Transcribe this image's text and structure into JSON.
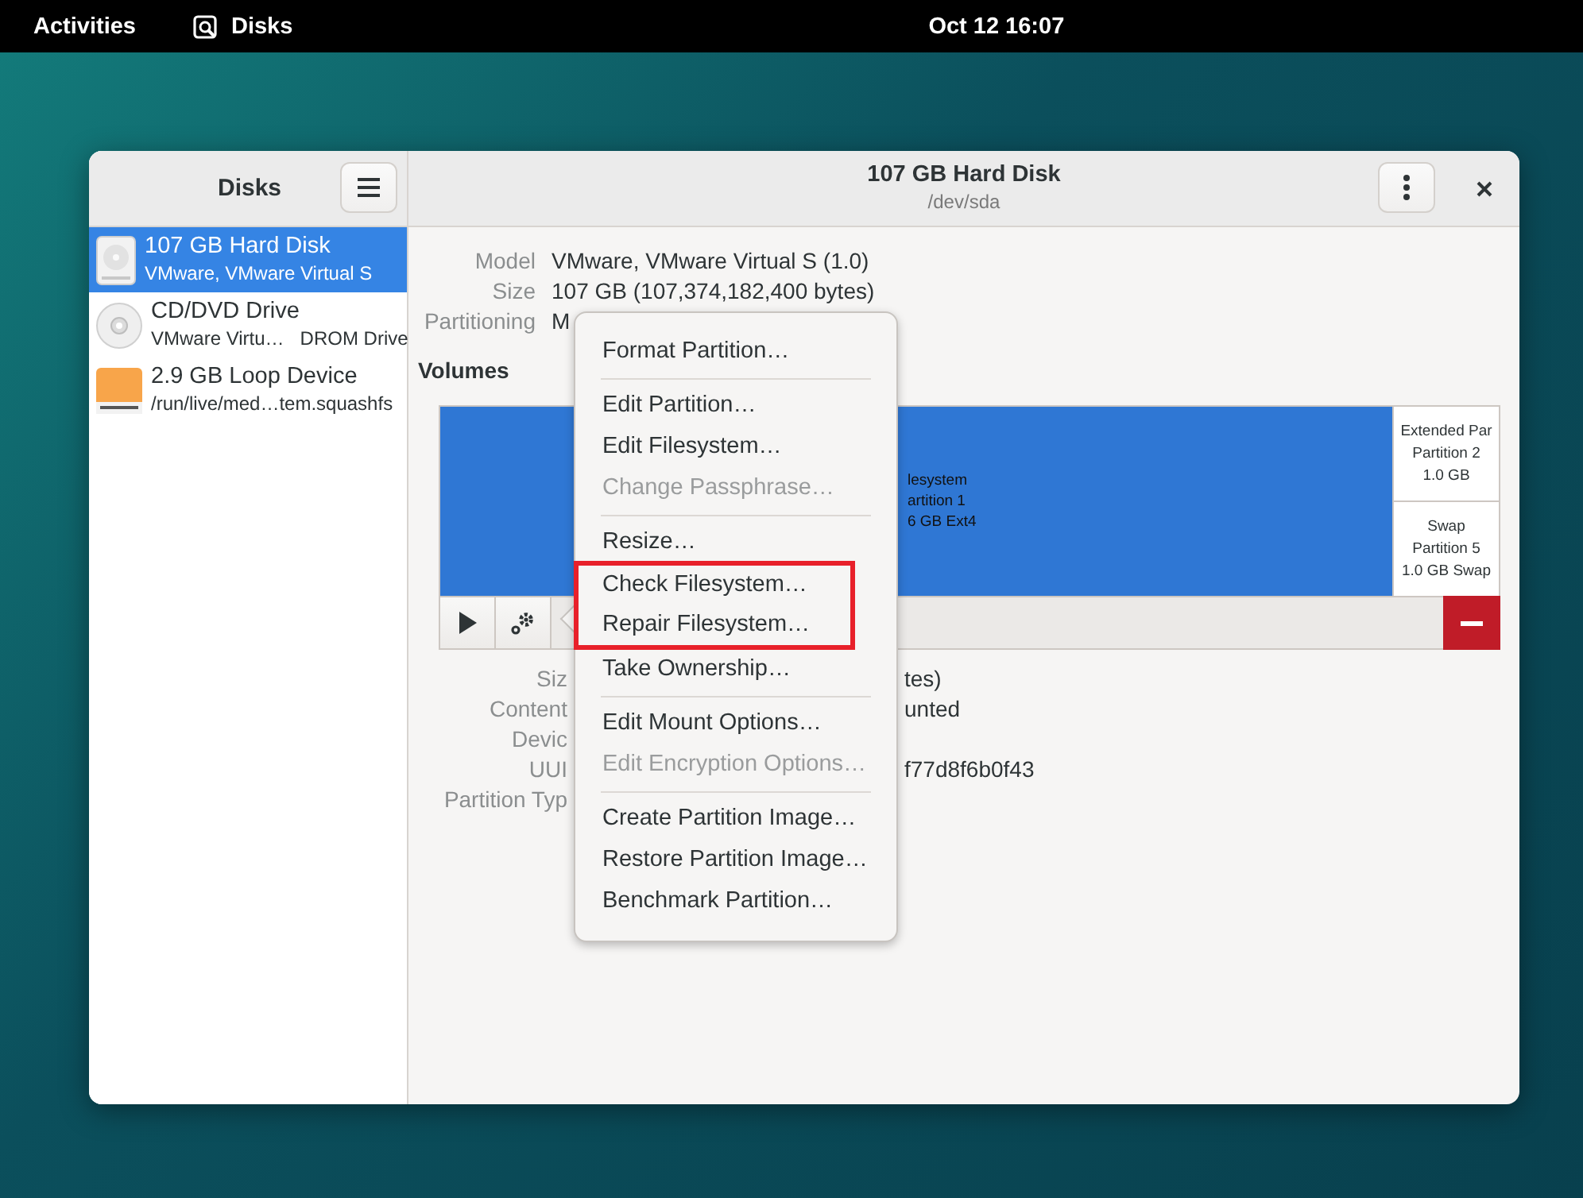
{
  "top_bar": {
    "activities": "Activities",
    "app_name": "Disks",
    "clock": "Oct 12  16:07"
  },
  "sidebar": {
    "title": "Disks",
    "items": [
      {
        "kind": "hard-disk",
        "title": "107 GB Hard Disk",
        "subtitle": "VMware, VMware Virtual S",
        "selected": true
      },
      {
        "kind": "optical",
        "title": "CD/DVD Drive",
        "subtitle": "VMware Virtu…   DROM Drive",
        "selected": false
      },
      {
        "kind": "loop",
        "title": "2.9 GB Loop Device",
        "subtitle": "/run/live/med…tem.squashfs",
        "selected": false
      }
    ]
  },
  "header": {
    "title": "107 GB Hard Disk",
    "subtitle": "/dev/sda"
  },
  "drive_details": [
    {
      "label": "Model",
      "value": "VMware, VMware Virtual S (1.0)"
    },
    {
      "label": "Size",
      "value": "107 GB (107,374,182,400 bytes)"
    },
    {
      "label": "Partitioning",
      "value": "M"
    }
  ],
  "volumes": {
    "title": "Volumes",
    "main": {
      "lines": [
        "lesystem",
        "artition 1",
        "6 GB Ext4"
      ],
      "selected": true
    },
    "side": [
      {
        "lines": [
          "Extended Par",
          "Partition 2",
          "1.0 GB"
        ],
        "selected": false
      },
      {
        "lines": [
          "Swap",
          "Partition 5",
          "1.0 GB Swap"
        ],
        "selected": false
      }
    ]
  },
  "volume_details": [
    {
      "label": "Siz",
      "value": "tes)"
    },
    {
      "label": "Content",
      "value": "unted"
    },
    {
      "label": "Devic"
    },
    {
      "label": "UUI",
      "value": "f77d8f6b0f43"
    },
    {
      "label": "Partition Typ"
    }
  ],
  "menu": {
    "groups": [
      {
        "items": [
          {
            "label": "Format Partition…",
            "disabled": false,
            "highlighted": false
          }
        ]
      },
      {
        "items": [
          {
            "label": "Edit Partition…",
            "disabled": false,
            "highlighted": false
          },
          {
            "label": "Edit Filesystem…",
            "disabled": false,
            "highlighted": false
          },
          {
            "label": "Change Passphrase…",
            "disabled": true,
            "highlighted": false
          }
        ]
      },
      {
        "items": [
          {
            "label": "Resize…",
            "disabled": false,
            "highlighted": false
          },
          {
            "label": "Check Filesystem…",
            "disabled": false,
            "highlighted": true
          },
          {
            "label": "Repair Filesystem…",
            "disabled": false,
            "highlighted": true
          },
          {
            "label": "Take Ownership…",
            "disabled": false,
            "highlighted": false
          }
        ]
      },
      {
        "items": [
          {
            "label": "Edit Mount Options…",
            "disabled": false,
            "highlighted": false
          },
          {
            "label": "Edit Encryption Options…",
            "disabled": true,
            "highlighted": false
          }
        ]
      },
      {
        "items": [
          {
            "label": "Create Partition Image…",
            "disabled": false,
            "highlighted": false
          },
          {
            "label": "Restore Partition Image…",
            "disabled": false,
            "highlighted": false
          },
          {
            "label": "Benchmark Partition…",
            "disabled": false,
            "highlighted": false
          }
        ]
      }
    ]
  }
}
